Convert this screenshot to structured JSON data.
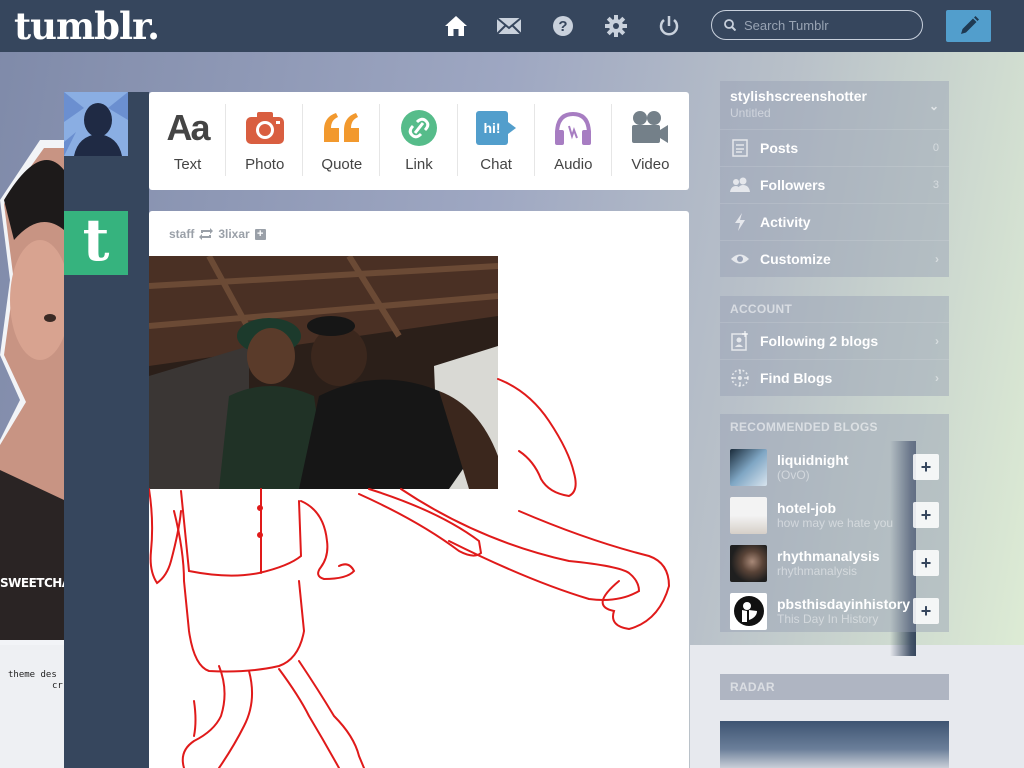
{
  "header": {
    "logo": "tumblr.",
    "nav": [
      "home-icon",
      "mail-icon",
      "help-icon",
      "settings-icon",
      "power-icon"
    ],
    "search_placeholder": "Search Tumblr",
    "compose_icon": "pencil-icon"
  },
  "background": {
    "photo_caption": "SWEETCHAY",
    "credit_line1": "theme des",
    "credit_line2": "cr"
  },
  "post_types": [
    {
      "label": "Text",
      "icon": "text-icon",
      "color": "#444444"
    },
    {
      "label": "Photo",
      "icon": "camera-icon",
      "color": "#d95e40"
    },
    {
      "label": "Quote",
      "icon": "quote-icon",
      "color": "#f2992e"
    },
    {
      "label": "Link",
      "icon": "link-icon",
      "color": "#56bc8a"
    },
    {
      "label": "Chat",
      "icon": "chat-icon",
      "color": "#529ecc"
    },
    {
      "label": "Audio",
      "icon": "headphones-icon",
      "color": "#a77dc2"
    },
    {
      "label": "Video",
      "icon": "video-camera-icon",
      "color": "#748089"
    }
  ],
  "post": {
    "author": "staff",
    "reblogged_from": "3lixar",
    "plus_icon": "+"
  },
  "sidebar": {
    "blog_name": "stylishscreenshotter",
    "blog_title": "Untitled",
    "items": [
      {
        "label": "Posts",
        "count": "0",
        "icon": "posts-icon"
      },
      {
        "label": "Followers",
        "count": "3",
        "icon": "followers-icon"
      },
      {
        "label": "Activity",
        "count": "",
        "icon": "lightning-icon"
      },
      {
        "label": "Customize",
        "count": "",
        "icon": "eye-icon"
      }
    ],
    "account_heading": "ACCOUNT",
    "account_items": [
      {
        "label": "Following 2 blogs",
        "icon": "following-icon"
      },
      {
        "label": "Find Blogs",
        "icon": "compass-icon"
      }
    ],
    "recommended_heading": "RECOMMENDED BLOGS",
    "recommended": [
      {
        "name": "liquidnight",
        "subtitle": "(OvO)"
      },
      {
        "name": "hotel-job",
        "subtitle": "how may we hate you"
      },
      {
        "name": "rhythmanalysis",
        "subtitle": "rhythmanalysis"
      },
      {
        "name": "pbsthisdayinhistory",
        "subtitle": "This Day In History"
      }
    ],
    "radar_heading": "RADAR"
  },
  "colors": {
    "navy": "#36465d",
    "compose_blue": "#529ecc",
    "tumblr_green": "#36b37e"
  }
}
